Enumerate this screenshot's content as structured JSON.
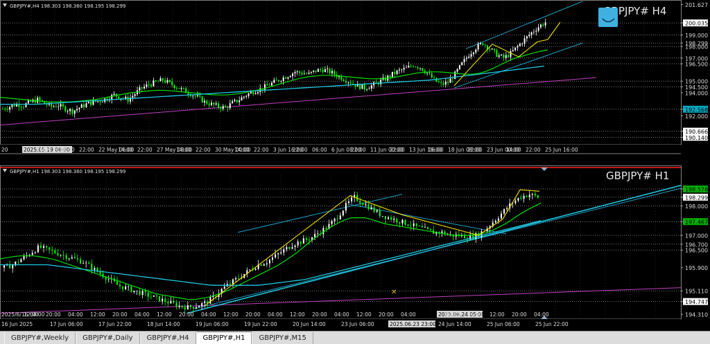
{
  "tabs": [
    {
      "label": "GBPJPY#,Weekly"
    },
    {
      "label": "GBPJPY#,Daily"
    },
    {
      "label": "GBPJPY#,H4"
    },
    {
      "label": "GBPJPY#,H1",
      "active": true
    },
    {
      "label": "GBPJPY#,M15"
    }
  ],
  "colors": {
    "background": "#000000",
    "grid": "#5a5a5a",
    "bull": "#ffffff",
    "bear": "#00ff00",
    "ma_fast": "#00e000",
    "ma_slow": "#1ec8e0",
    "trendline": "#1ea0c8",
    "magenta": "#c040c0",
    "yellow": "#f0e000",
    "axis_text": "#dcdcdc",
    "highlight_green": "#00b000",
    "highlight_cyan": "#00a8c0",
    "tick_red": "#ff0000"
  },
  "chart_data": [
    {
      "type": "candlestick",
      "info": "GBPJPY#,H4  198.303 198.360 198.195 198.299",
      "symbol_label": "GBPJPY# H4",
      "ylim": [
        189.5,
        201.9
      ],
      "y_ticks": [
        {
          "label": "201.627",
          "value": 201.627,
          "style": "plain"
        },
        {
          "label": "200.035",
          "value": 200.035,
          "style": "white"
        },
        {
          "label": "199.000",
          "value": 199.0,
          "style": "plain"
        },
        {
          "label": "198.299",
          "value": 198.299,
          "style": "plain"
        },
        {
          "label": "198.000",
          "value": 198.0,
          "style": "plain"
        },
        {
          "label": "197.000",
          "value": 197.0,
          "style": "plain"
        },
        {
          "label": "196.500",
          "value": 196.5,
          "style": "plain"
        },
        {
          "label": "195.000",
          "value": 195.0,
          "style": "plain"
        },
        {
          "label": "194.500",
          "value": 194.5,
          "style": "plain"
        },
        {
          "label": "194.000",
          "value": 194.0,
          "style": "plain"
        },
        {
          "label": "192.568",
          "value": 192.568,
          "style": "cyan"
        },
        {
          "label": "192.000",
          "value": 192.0,
          "style": "plain"
        },
        {
          "label": "190.666",
          "value": 190.666,
          "style": "white"
        },
        {
          "label": "190.140",
          "value": 190.14,
          "style": "white"
        }
      ],
      "h_lines": [
        200.035,
        199.0,
        198.299,
        198.0,
        197.0,
        196.5,
        195.0,
        194.5,
        192.568,
        190.666,
        190.14
      ],
      "x_labels": [
        "20",
        "2025.05.19 06:00",
        "May 06:00",
        "14:00",
        "22:00",
        "22 May 06:00",
        "14:00",
        "22:00",
        "27 May 08:00",
        "14:00",
        "22:00",
        "30 May 00:00",
        "14:00",
        "22:00",
        "3 Jun 16:00",
        "22:00",
        "06:00",
        "6 Jun 08:00",
        "22:00",
        "11 Jun 00:00",
        "22:00",
        "13 Jun 16:00",
        "06:00",
        "18 Jun 08:00",
        "22:00",
        "23 Jun 00:00",
        "14:00",
        "22:00",
        "25 Jun 16:00"
      ],
      "x_label_top": "15",
      "close_path": [
        192.6,
        192.8,
        193.0,
        192.9,
        193.2,
        193.4,
        193.1,
        192.8,
        192.9,
        192.6,
        192.4,
        192.7,
        193.0,
        193.2,
        193.3,
        193.5,
        193.8,
        193.6,
        193.4,
        193.9,
        194.4,
        194.7,
        194.9,
        195.1,
        194.8,
        194.5,
        194.2,
        193.9,
        193.6,
        193.2,
        193.0,
        192.8,
        192.7,
        193.1,
        193.4,
        193.8,
        194.1,
        194.3,
        194.6,
        194.9,
        195.2,
        195.5,
        195.8,
        195.7,
        195.6,
        195.9,
        196.0,
        195.8,
        195.5,
        195.2,
        194.9,
        194.6,
        194.4,
        194.6,
        194.9,
        195.2,
        195.6,
        195.9,
        196.1,
        196.4,
        196.2,
        195.7,
        195.1,
        194.7,
        194.9,
        195.6,
        196.5,
        197.3,
        197.9,
        198.3,
        197.8,
        197.3,
        197.0,
        197.4,
        198.0,
        198.6,
        199.2,
        199.7,
        200.1
      ],
      "ma_fast": [
        193.6,
        193.5,
        193.4,
        193.3,
        193.2,
        193.2,
        193.2,
        193.3,
        193.4,
        193.6,
        193.8,
        194.0,
        194.1,
        194.2,
        194.2,
        194.1,
        194.0,
        193.9,
        193.8,
        193.8,
        193.9,
        194.1,
        194.3,
        194.6,
        194.9,
        195.2,
        195.4,
        195.5,
        195.5,
        195.4,
        195.3,
        195.2,
        195.2,
        195.3,
        195.5,
        195.7,
        195.8,
        195.8,
        195.7,
        195.6,
        195.6,
        195.9,
        196.4,
        196.9,
        197.2,
        197.5,
        197.7
      ],
      "ma_slow": [
        193.0,
        193.0,
        193.0,
        193.1,
        193.2,
        193.3,
        193.4,
        193.5,
        193.6,
        193.7,
        193.8,
        193.9,
        194.0,
        194.1,
        194.2,
        194.3,
        194.4,
        194.5,
        194.6,
        194.7,
        194.8,
        194.9,
        195.0,
        195.1,
        195.3,
        195.5,
        195.7,
        195.9,
        196.1,
        196.3
      ]
    },
    {
      "type": "candlestick",
      "info": "GBPJPY#,H1  198.303 198.360 198.195 198.299",
      "symbol_label": "GBPJPY# H1",
      "ylim": [
        194.15,
        199.05
      ],
      "y_ticks": [
        {
          "label": "198.578",
          "value": 198.578,
          "style": "green"
        },
        {
          "label": "198.299",
          "value": 198.299,
          "style": "white"
        },
        {
          "label": "198.000",
          "value": 198.0,
          "style": "plain"
        },
        {
          "label": "197.467",
          "value": 197.467,
          "style": "green"
        },
        {
          "label": "197.000",
          "value": 197.0,
          "style": "plain"
        },
        {
          "label": "196.700",
          "value": 196.7,
          "style": "plain"
        },
        {
          "label": "196.500",
          "value": 196.5,
          "style": "plain"
        },
        {
          "label": "195.900",
          "value": 195.9,
          "style": "plain"
        },
        {
          "label": "195.110",
          "value": 195.11,
          "style": "plain"
        },
        {
          "label": "194.747",
          "value": 194.747,
          "style": "white"
        },
        {
          "label": "194.310",
          "value": 194.31,
          "style": "plain"
        }
      ],
      "h_lines": [
        198.578,
        198.299,
        198.0,
        197.467,
        197.0,
        196.7,
        196.5,
        195.11,
        194.747
      ],
      "x_labels": [
        "16 Jun 2025",
        "17 Jun 06:00",
        "17 Jun 22:00",
        "18 Jun 14:00",
        "19 Jun 06:00",
        "19 Jun 22:00",
        "20 Jun 14:00",
        "23 Jun 06:00",
        "2025.06.23 23:00",
        "24 Jun 14:00",
        "25 Jun 06:00",
        "25 Jun 22:00"
      ],
      "x_labels_top": [
        "2025/6/16 04:00",
        "12:00",
        "20:00",
        "04:00",
        "12:00",
        "20:00",
        "04:00",
        "12:00",
        "20:00",
        "04:00",
        "12:00",
        "20:00",
        "04:00",
        "12:00",
        "20:00",
        "04:00",
        "12:00",
        "20:00",
        "04:00",
        "2025.06.24 05:00",
        "20:00",
        "04:00",
        "12:00",
        "20:00",
        "04:00"
      ],
      "close_path": [
        195.9,
        196.0,
        196.2,
        196.4,
        196.6,
        196.5,
        196.4,
        196.3,
        196.2,
        196.1,
        195.9,
        195.7,
        195.5,
        195.3,
        195.2,
        195.1,
        195.0,
        194.9,
        194.8,
        194.7,
        194.6,
        194.55,
        194.6,
        194.7,
        194.9,
        195.2,
        195.4,
        195.6,
        195.8,
        196.0,
        196.1,
        196.3,
        196.5,
        196.7,
        196.8,
        196.9,
        197.1,
        197.3,
        197.6,
        198.0,
        198.3,
        198.1,
        197.9,
        197.7,
        197.6,
        197.5,
        197.4,
        197.3,
        197.2,
        197.1,
        197.1,
        197.0,
        197.0,
        196.95,
        197.0,
        197.2,
        197.5,
        197.8,
        198.1,
        198.3,
        198.4,
        198.3
      ]
    }
  ]
}
